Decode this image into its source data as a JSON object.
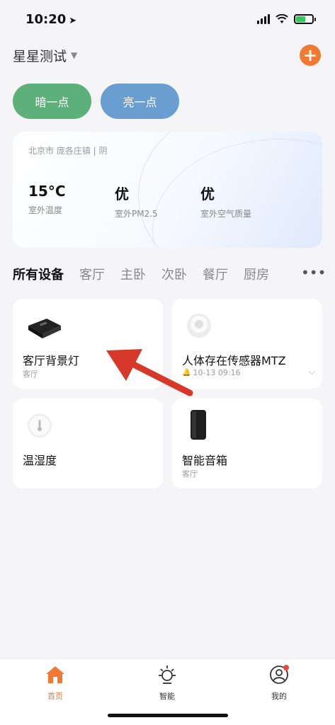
{
  "status": {
    "time": "10:20"
  },
  "header": {
    "home_name": "星星测试"
  },
  "scenes": {
    "dim": "暗一点",
    "bright": "亮一点"
  },
  "weather": {
    "location": "北京市 庞各庄镇 | 阴",
    "metrics": [
      {
        "value": "15°C",
        "label": "室外温度"
      },
      {
        "value": "优",
        "label": "室外PM2.5"
      },
      {
        "value": "优",
        "label": "室外空气质量"
      }
    ]
  },
  "tabs": [
    "所有设备",
    "客厅",
    "主卧",
    "次卧",
    "餐厅",
    "厨房"
  ],
  "devices": [
    {
      "name": "客厅背景灯",
      "room": "客厅"
    },
    {
      "name": "人体存在传感器MTZ",
      "room": "10-13 09:16"
    },
    {
      "name": "温湿度",
      "room": ""
    },
    {
      "name": "智能音箱",
      "room": "客厅"
    }
  ],
  "tabbar": [
    {
      "label": "首页",
      "icon": "home-icon"
    },
    {
      "label": "智能",
      "icon": "sun-icon"
    },
    {
      "label": "我的",
      "icon": "profile-icon"
    }
  ],
  "colors": {
    "accent": "#f07a34",
    "dim_btn": "#5db07a",
    "bright_btn": "#6a9ed0",
    "arrow": "#d6382a"
  }
}
